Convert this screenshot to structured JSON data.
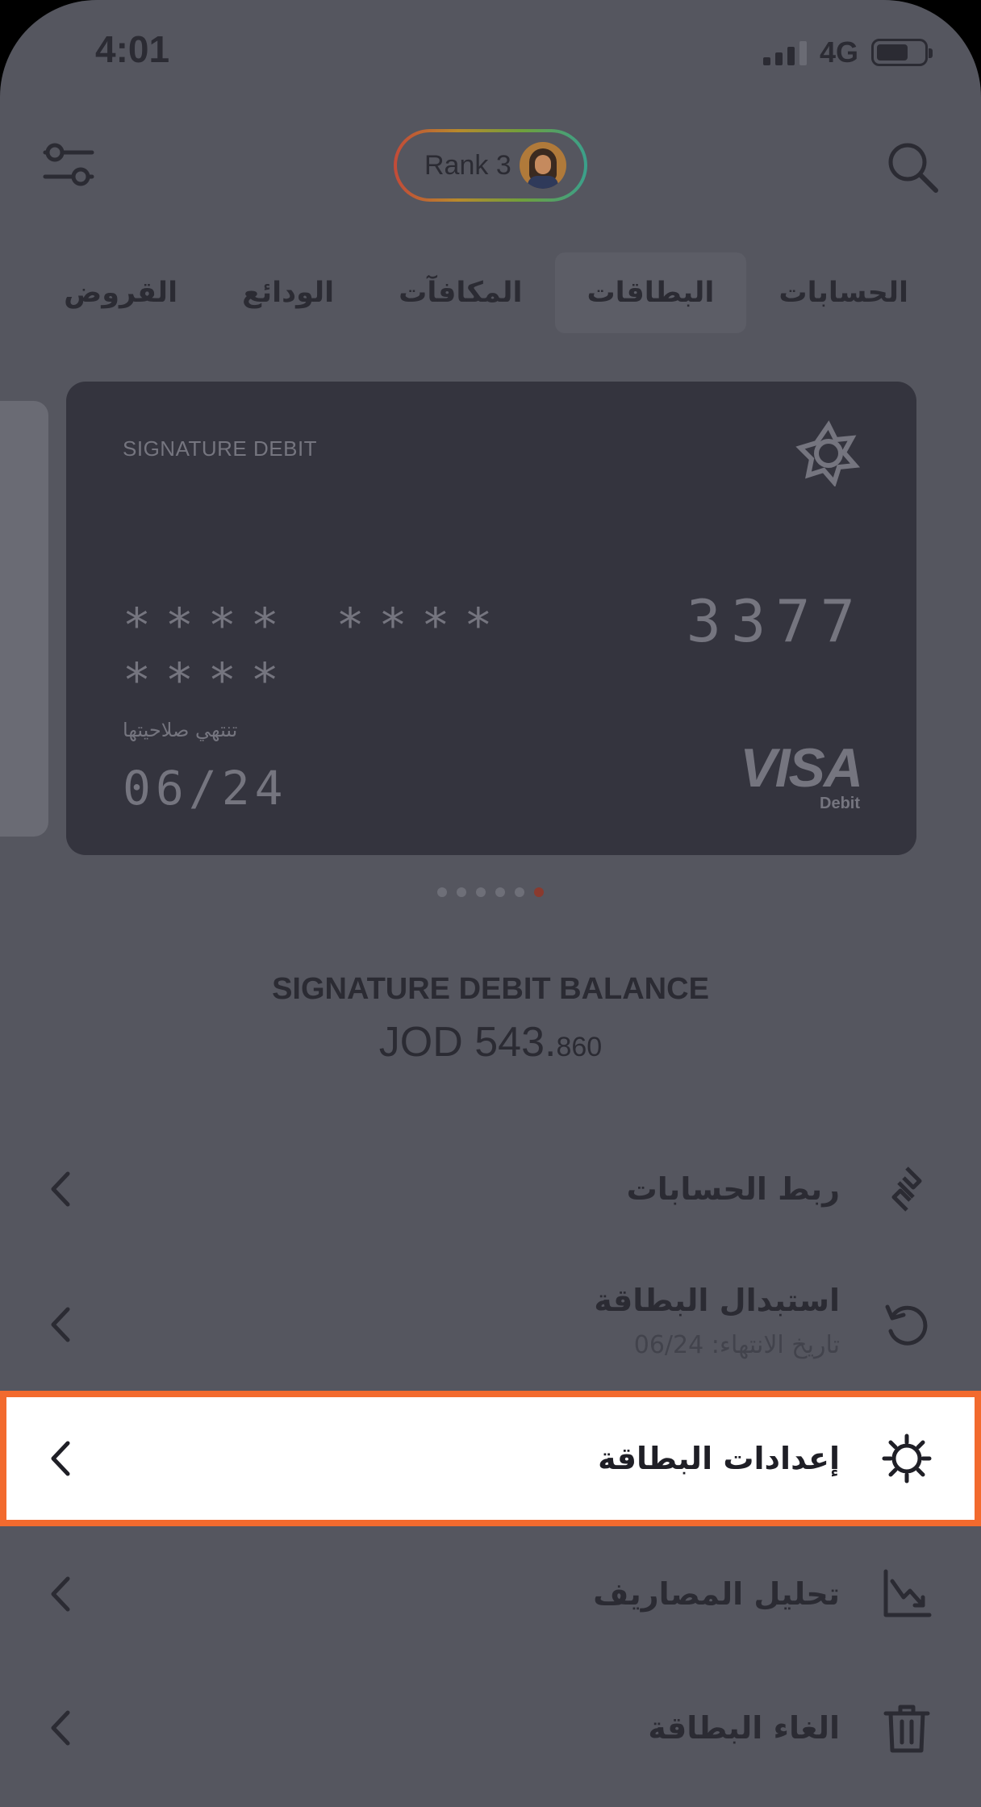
{
  "status_bar": {
    "time": "4:01",
    "network": "4G"
  },
  "header": {
    "rank_label": "Rank 3",
    "filter_icon": "filter-sliders-icon",
    "search_icon": "search-icon"
  },
  "tabs": [
    {
      "label": "الحسابات",
      "active": false
    },
    {
      "label": "البطاقات",
      "active": true
    },
    {
      "label": "المكافآت",
      "active": false
    },
    {
      "label": "الودائع",
      "active": false
    },
    {
      "label": "القروض",
      "active": false
    }
  ],
  "card": {
    "type_label": "SIGNATURE DEBIT",
    "masked_groups": "**** **** ****",
    "last4": "3377",
    "expiry_label": "تنتهي صلاحيتها",
    "expiry": "06/24",
    "brand": "VISA",
    "brand_sub": "Debit"
  },
  "carousel": {
    "dot_count": 6,
    "active_dot": 6
  },
  "balance": {
    "title": "SIGNATURE DEBIT BALANCE",
    "amount_main": "JOD 543.",
    "amount_fraction": "860"
  },
  "menu": [
    {
      "label": "ربط الحسابات",
      "icon": "link-accounts-icon"
    },
    {
      "label": "استبدال البطاقة",
      "sub": "تاريخ الانتهاء: 06/24",
      "icon": "replace-refresh-icon"
    },
    {
      "label": "إعدادات البطاقة",
      "icon": "gear-icon",
      "highlighted": true
    },
    {
      "label": "تحليل المصاريف",
      "icon": "chart-trend-icon"
    },
    {
      "label": "الغاء البطاقة",
      "icon": "trash-icon"
    }
  ],
  "colors": {
    "overlay_bg": "#55565f",
    "card_bg": "#34343e",
    "highlight_border": "#f26a2e",
    "active_dot": "#8a3a2e"
  }
}
